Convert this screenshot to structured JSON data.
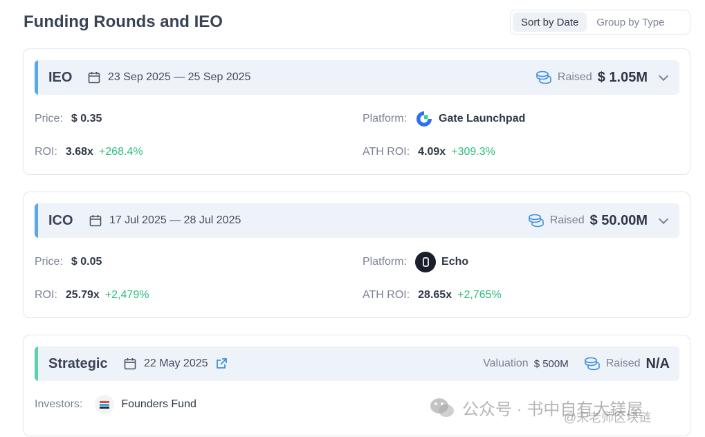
{
  "title": "Funding Rounds and IEO",
  "toggle": {
    "sort_by_date": "Sort by Date",
    "group_by_type": "Group by Type"
  },
  "rounds": [
    {
      "type": "IEO",
      "dates": "23 Sep 2025 — 25 Sep 2025",
      "raised_label": "Raised",
      "raised_value": "$ 1.05M",
      "price_label": "Price:",
      "price": "$ 0.35",
      "platform_label": "Platform:",
      "platform": "Gate Launchpad",
      "roi_label": "ROI:",
      "roi": "3.68x",
      "roi_pct": "+268.4%",
      "ath_roi_label": "ATH ROI:",
      "ath_roi": "4.09x",
      "ath_roi_pct": "+309.3%"
    },
    {
      "type": "ICO",
      "dates": "17 Jul 2025 — 28 Jul 2025",
      "raised_label": "Raised",
      "raised_value": "$ 50.00M",
      "price_label": "Price:",
      "price": "$ 0.05",
      "platform_label": "Platform:",
      "platform": "Echo",
      "roi_label": "ROI:",
      "roi": "25.79x",
      "roi_pct": "+2,479%",
      "ath_roi_label": "ATH ROI:",
      "ath_roi": "28.65x",
      "ath_roi_pct": "+2,765%"
    },
    {
      "type": "Strategic",
      "dates": "22 May 2025",
      "valuation_label": "Valuation",
      "valuation_value": "$ 500M",
      "raised_label": "Raised",
      "raised_value": "N/A",
      "investors_label": "Investors:",
      "investor": "Founders Fund"
    }
  ],
  "watermark": {
    "line1": "公众号 · 书中自有大镁屋",
    "line2": "@宋老师区块链"
  },
  "colors": {
    "accent_blue": "#5aa8e8",
    "accent_green": "#5fd0ad",
    "positive": "#2bbd7e",
    "bar_bg": "#eef2f9"
  },
  "icons": [
    "calendar-icon",
    "coins-icon",
    "chevron-down-icon",
    "external-link-icon",
    "gate-logo-icon",
    "echo-logo-icon",
    "founders-fund-logo-icon",
    "wechat-icon"
  ]
}
